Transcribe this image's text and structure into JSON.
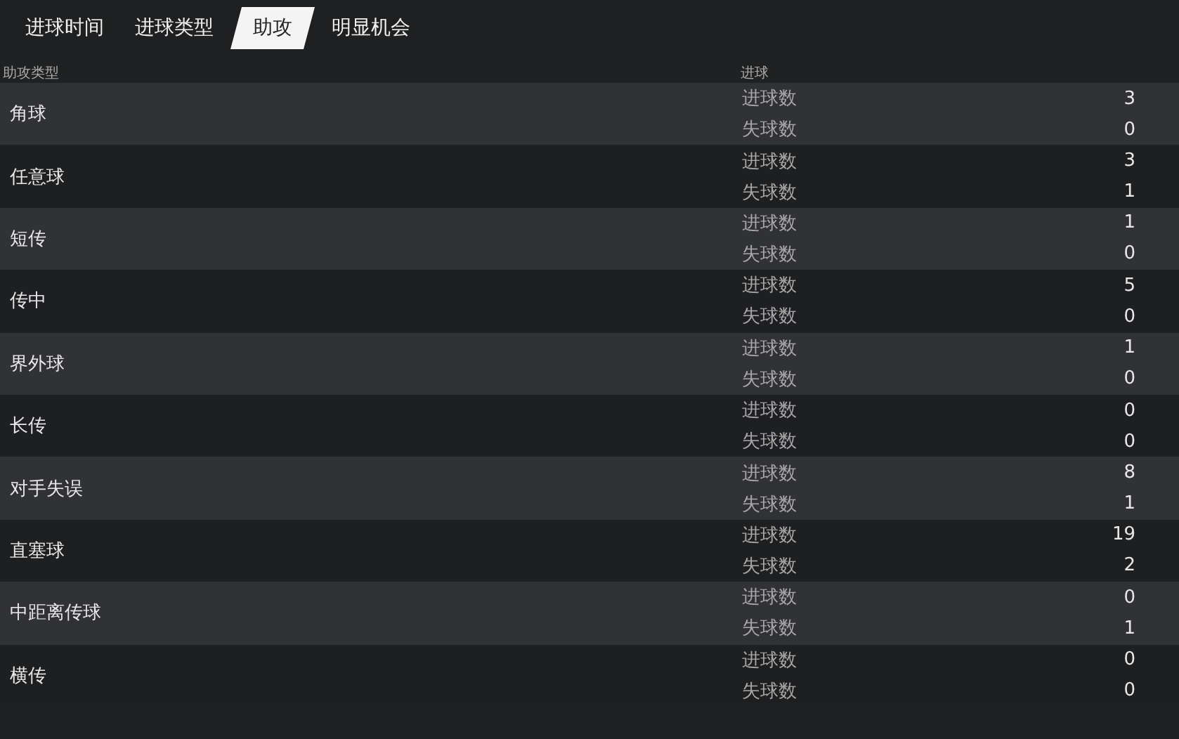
{
  "tabs": [
    {
      "label": "进球时间",
      "selected": false
    },
    {
      "label": "进球类型",
      "selected": false
    },
    {
      "label": "助攻",
      "selected": true
    },
    {
      "label": "明显机会",
      "selected": false
    }
  ],
  "table": {
    "columns": [
      "助攻类型",
      "进球"
    ],
    "rows": [
      {
        "type": "角球",
        "lines": [
          {
            "label": "进球数",
            "value": "3"
          },
          {
            "label": "失球数",
            "value": "0"
          }
        ]
      },
      {
        "type": "任意球",
        "lines": [
          {
            "label": "进球数",
            "value": "3"
          },
          {
            "label": "失球数",
            "value": "1"
          }
        ]
      },
      {
        "type": "短传",
        "lines": [
          {
            "label": "进球数",
            "value": "1"
          },
          {
            "label": "失球数",
            "value": "0"
          }
        ]
      },
      {
        "type": "传中",
        "lines": [
          {
            "label": "进球数",
            "value": "5"
          },
          {
            "label": "失球数",
            "value": "0"
          }
        ]
      },
      {
        "type": "界外球",
        "lines": [
          {
            "label": "进球数",
            "value": "1"
          },
          {
            "label": "失球数",
            "value": "0"
          }
        ]
      },
      {
        "type": "长传",
        "lines": [
          {
            "label": "进球数",
            "value": "0"
          },
          {
            "label": "失球数",
            "value": "0"
          }
        ]
      },
      {
        "type": "对手失误",
        "lines": [
          {
            "label": "进球数",
            "value": "8"
          },
          {
            "label": "失球数",
            "value": "1"
          }
        ]
      },
      {
        "type": "直塞球",
        "lines": [
          {
            "label": "进球数",
            "value": "19"
          },
          {
            "label": "失球数",
            "value": "2"
          }
        ]
      },
      {
        "type": "中距离传球",
        "lines": [
          {
            "label": "进球数",
            "value": "0"
          },
          {
            "label": "失球数",
            "value": "1"
          }
        ]
      },
      {
        "type": "横传",
        "lines": [
          {
            "label": "进球数",
            "value": "0"
          },
          {
            "label": "失球数",
            "value": "0"
          }
        ]
      }
    ]
  }
}
